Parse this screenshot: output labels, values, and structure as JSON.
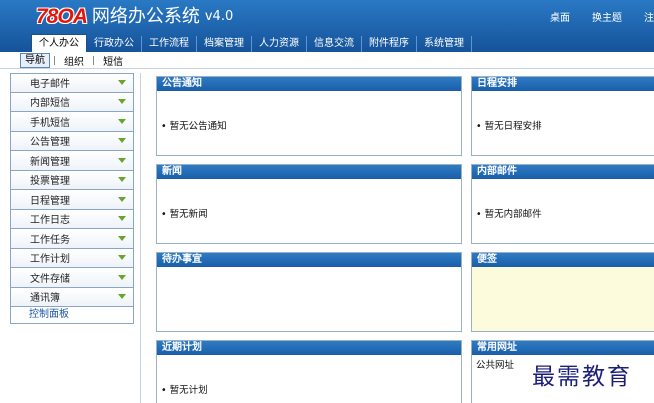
{
  "header": {
    "logo_mark": "78OA",
    "title": "网络办公系统",
    "version": "v4.0",
    "links": [
      "桌面",
      "换主题",
      "注"
    ]
  },
  "tabs": [
    "个人办公",
    "行政办公",
    "工作流程",
    "档案管理",
    "人力资源",
    "信息交流",
    "附件程序",
    "系统管理"
  ],
  "subnav": [
    "导航",
    "组织",
    "短信"
  ],
  "sidebar": {
    "items": [
      "电子邮件",
      "内部短信",
      "手机短信",
      "公告管理",
      "新闻管理",
      "投票管理",
      "日程管理",
      "工作日志",
      "工作任务",
      "工作计划",
      "文件存储",
      "通讯簿"
    ],
    "control": "控制面板"
  },
  "panels": {
    "announce": {
      "title": "公告通知",
      "text": "• 暂无公告通知"
    },
    "schedule": {
      "title": "日程安排",
      "text": "• 暂无日程安排"
    },
    "news": {
      "title": "新闻",
      "text": "• 暂无新闻"
    },
    "mail": {
      "title": "内部邮件",
      "text": "• 暂无内部邮件"
    },
    "todo": {
      "title": "待办事宜",
      "text": ""
    },
    "note": {
      "title": "便签",
      "text": ""
    },
    "plan": {
      "title": "近期计划",
      "text": "• 暂无计划"
    },
    "links": {
      "title": "常用网址",
      "text": "公共网址"
    }
  },
  "watermark": "最需教育"
}
